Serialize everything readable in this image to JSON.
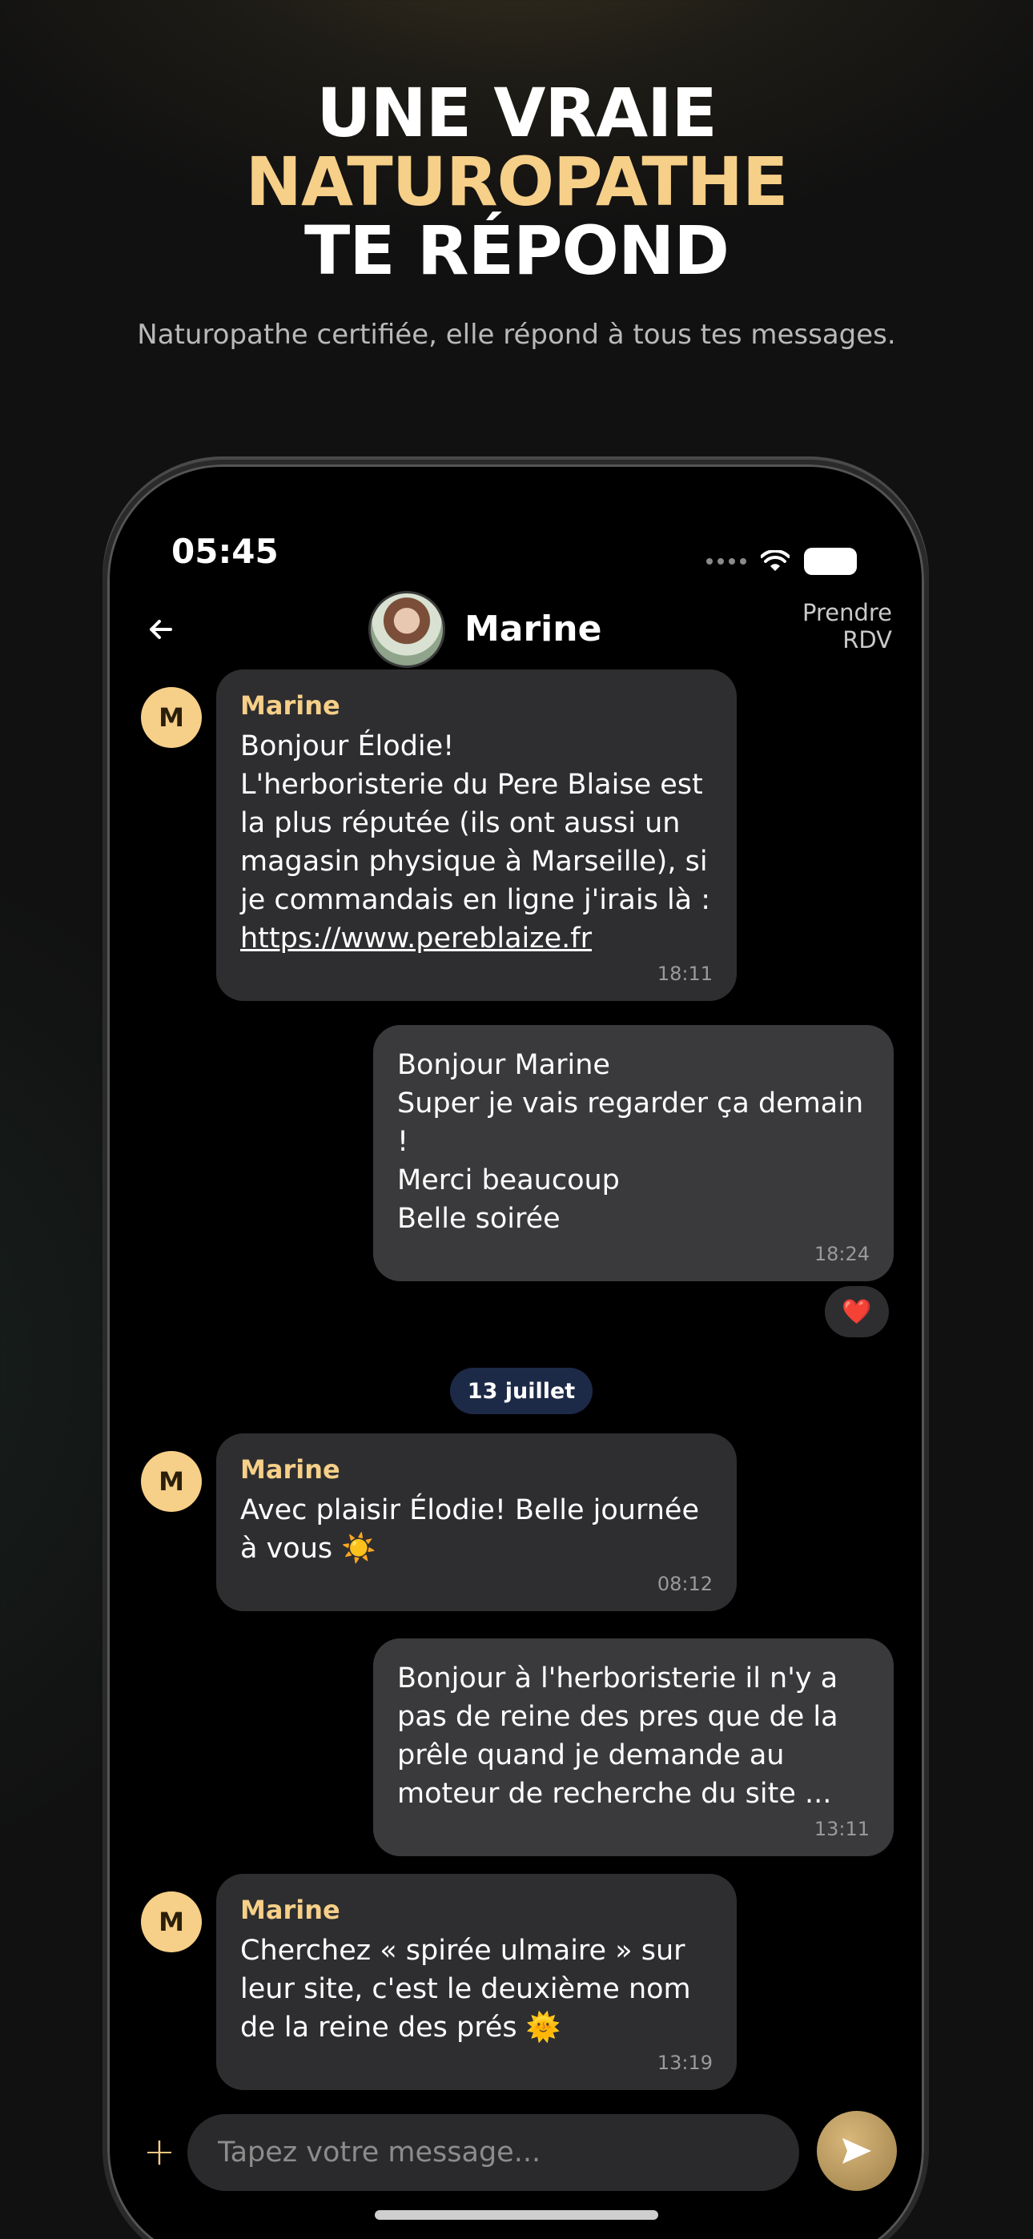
{
  "hero": {
    "title_line1": "UNE VRAIE",
    "title_line2": "NATUROPATHE",
    "title_line3": "TE RÉPOND",
    "subtitle": "Naturopathe certifiée, elle répond à tous tes messages."
  },
  "statusbar": {
    "time": "05:45"
  },
  "header": {
    "contact_name": "Marine",
    "rdv_label": "Prendre RDV"
  },
  "messages": [
    {
      "sender": "Marine",
      "avatar_initial": "M",
      "text": "Bonjour Élodie!\nL'herboristerie du Pere Blaise est la plus réputée (ils ont aussi un magasin physique à Marseille), si je commandais en ligne j'irais là :",
      "link": "https://www.pereblaize.fr",
      "time": "18:11"
    },
    {
      "text": "Bonjour Marine\nSuper je vais regarder ça demain !\nMerci beaucoup\nBelle soirée",
      "time": "18:24",
      "reaction": "❤️"
    },
    {
      "sender": "Marine",
      "avatar_initial": "M",
      "text": "Avec plaisir Élodie! Belle journée à vous ☀️",
      "time": "08:12"
    },
    {
      "text": "Bonjour à l'herboristerie il n'y a pas de reine des pres que de la prêle quand je demande au moteur de recherche du site ...",
      "time": "13:11"
    },
    {
      "sender": "Marine",
      "avatar_initial": "M",
      "text": "Cherchez « spirée ulmaire » sur leur site, c'est le deuxième nom de la reine des prés 🌞",
      "time": "13:19"
    }
  ],
  "date_separator": "13 juillet",
  "composer": {
    "placeholder": "Tapez votre message..."
  },
  "colors": {
    "accent": "#f6cf88",
    "bubble_in": "#2e2e30",
    "bubble_out": "#3a3a3c",
    "date_pill": "#1d2a47"
  },
  "icons": [
    "back-arrow-icon",
    "wifi-icon",
    "battery-icon",
    "plus-icon",
    "send-icon",
    "heart-icon"
  ]
}
